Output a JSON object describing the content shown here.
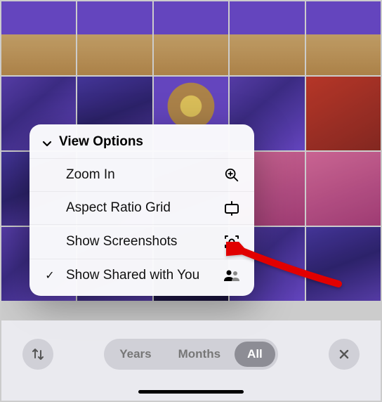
{
  "popover": {
    "title": "View Options",
    "items": [
      {
        "label": "Zoom In",
        "icon": "zoom-in-icon",
        "checked": false
      },
      {
        "label": "Aspect Ratio Grid",
        "icon": "aspect-ratio-icon",
        "checked": false
      },
      {
        "label": "Show Screenshots",
        "icon": "screenshot-icon",
        "checked": false
      },
      {
        "label": "Show Shared with You",
        "icon": "people-icon",
        "checked": true
      }
    ]
  },
  "segments": {
    "years": "Years",
    "months": "Months",
    "all": "All",
    "selected": "all"
  }
}
